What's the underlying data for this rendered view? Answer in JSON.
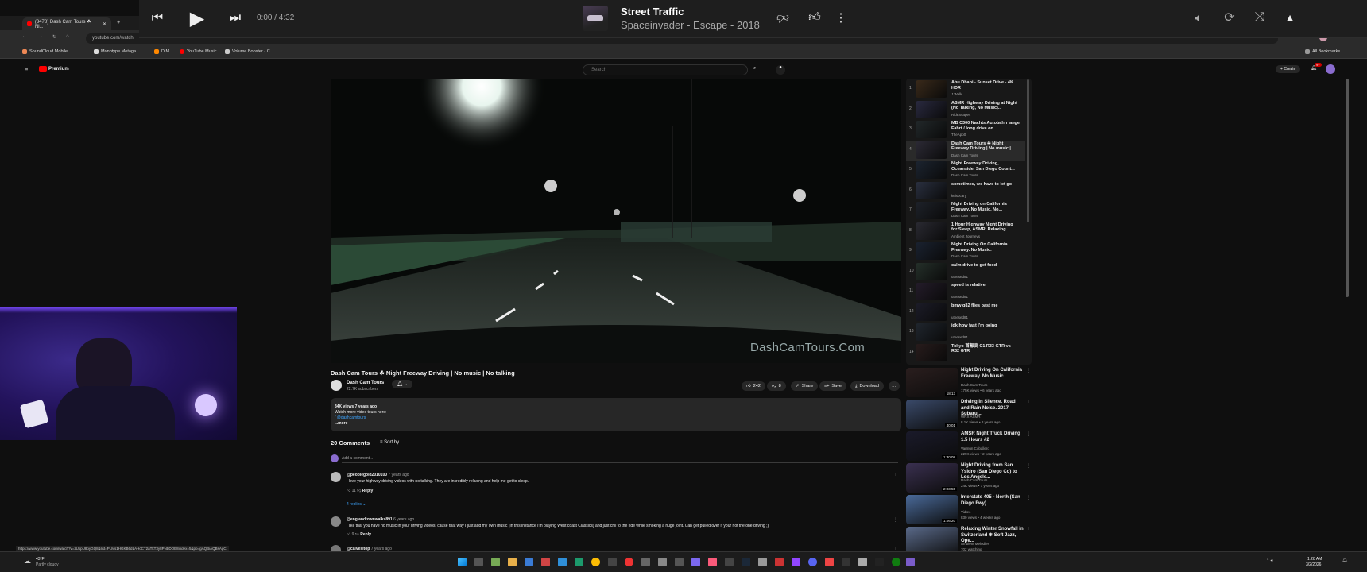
{
  "browser": {
    "tab_title": "(3478) Dash Cam Tours ☘ Ni...",
    "url": "youtube.com/watch",
    "bookmarks": [
      "SoundCloud Mobile",
      "Monotype Metaga...",
      "DIM",
      "YouTube Music",
      "Volume Booster - C..."
    ],
    "all_bookmarks": "All Bookmarks",
    "status_url": "https://www.youtube.com/watch?v=zUkpU8oyGQ8&list=PLMs1HGKB6dLAHcCT2aTkT3y8PNbDOE8index=5&pp=gAQBiAQBsAgC"
  },
  "music_player": {
    "time": "0:00 / 4:32",
    "track_title": "Street Traffic",
    "track_artist": "Spaceinvader - Escape - 2018"
  },
  "youtube": {
    "logo": "Premium",
    "search_placeholder": "Search",
    "create_label": "Create",
    "notif_count": "9+"
  },
  "video": {
    "watermark": "DashCamTours.Com",
    "title": "Dash Cam Tours ☘ Night Freeway Driving | No music | No talking",
    "channel": "Dash Cam Tours",
    "subscribers": "22.7K subscribers",
    "likes": "242",
    "dislikes": "8",
    "share": "Share",
    "save": "Save",
    "download": "Download",
    "desc_line1": "34K views  7 years ago",
    "desc_line2": "Watch more video tours here:",
    "desc_line3": "/ @dashcamtours",
    "desc_more": "...more"
  },
  "comments": {
    "count": "20 Comments",
    "sort": "Sort by",
    "add": "Add a comment...",
    "items": [
      {
        "user": "@peoplegold2010100",
        "when": "7 years ago",
        "text": "I love your highway driving videos with no talking. They are incredibly relaxing and help me get to sleep.",
        "likes": "11",
        "reply": "Reply",
        "replies": "4 replies"
      },
      {
        "user": "@englandtownwalks891",
        "when": "6 years ago",
        "text": "I like that you have no music in your driving videos, cause that way I just add my own music (In this instance I'm playing West coast Classics) and just chil to the ride while smoking a huge joint. Can get pulled over if your not the one driving ;)",
        "likes": "9",
        "reply": "Reply"
      },
      {
        "user": "@calvesltop",
        "when": "7 years ago"
      }
    ]
  },
  "playlist": [
    {
      "n": "1",
      "title": "Abu Dhabi - Sunset Drive - 4K HDR",
      "channel": "J Walk"
    },
    {
      "n": "2",
      "title": "ASMR Highway Driving at Night (No Talking, No Music)...",
      "channel": "RideScapes"
    },
    {
      "n": "3",
      "title": "MB C300 Nachts Autobahn lange Fahrt / long drive on...",
      "channel": "TheApp0"
    },
    {
      "n": "4",
      "title": "Dash Cam Tours ☘ Night Freeway Driving | No music |...",
      "channel": "Dash Cam Tours"
    },
    {
      "n": "5",
      "title": "Night Freeway Driving, Oceanside, San Diego Count...",
      "channel": "Dash Cam Tours"
    },
    {
      "n": "6",
      "title": "sometimes, we have to let go",
      "channel": "keisocary"
    },
    {
      "n": "7",
      "title": "Night Driving on California Freeway. No Music, No...",
      "channel": "Dash Cam Tours"
    },
    {
      "n": "8",
      "title": "1 Hour Highway Night Driving for Sleep, ASMR, Relaxing...",
      "channel": "Ambient Journeys"
    },
    {
      "n": "9",
      "title": "Night Driving On California Freeway. No Music.",
      "channel": "Dash Cam Tours"
    },
    {
      "n": "10",
      "title": "calm drive to get food",
      "channel": "uthesed81"
    },
    {
      "n": "11",
      "title": "speed is relative",
      "channel": "uthesed81"
    },
    {
      "n": "12",
      "title": "bmw g82 flies past me",
      "channel": "uthesed81"
    },
    {
      "n": "13",
      "title": "idk how fast I'm going",
      "channel": "uthesed81"
    },
    {
      "n": "14",
      "title": "Tokyo 首都高 C1 R33 GTR vs R32 GTR",
      "channel": ""
    }
  ],
  "recommended": [
    {
      "title": "Night Driving On California Freeway. No Music.",
      "channel": "Dash Cam Tours",
      "meta": "175K views • 6 years ago",
      "time": "18:13"
    },
    {
      "title": "Driving in Silence. Road and Rain Noise. 2017 Subaru...",
      "channel": "WRX ASMR",
      "meta": "8.1K views • 8 years ago",
      "time": "40:01"
    },
    {
      "title": "AMSR Night Truck Driving 1.5 Hours #2",
      "channel": "Varmun Coballero",
      "meta": "229K views • 2 years ago",
      "time": "1:30:08"
    },
    {
      "title": "Night Driving from San Ysidro (San Diego Co) to Los Angele...",
      "channel": "Dash Cam Tours",
      "meta": "24K views • 7 years ago",
      "time": "2:03:55"
    },
    {
      "title": "Interstate 405 - North (San Diego Fwy)",
      "channel": "Vidtec",
      "meta": "830 views • 4 weeks ago",
      "time": "1:06:20"
    },
    {
      "title": "Relaxing Winter Snowfall in Switzerland ❄ Soft Jazz, Ope...",
      "channel": "Ambient Melodies",
      "meta": "702 watching",
      "time": ""
    }
  ],
  "taskbar": {
    "temp": "43°F",
    "weather": "Partly cloudy",
    "time": "1:28 AM",
    "date": "3/2/2026"
  },
  "colors": {
    "accent_red": "#ff0000",
    "blue_link": "#3ea6ff"
  }
}
